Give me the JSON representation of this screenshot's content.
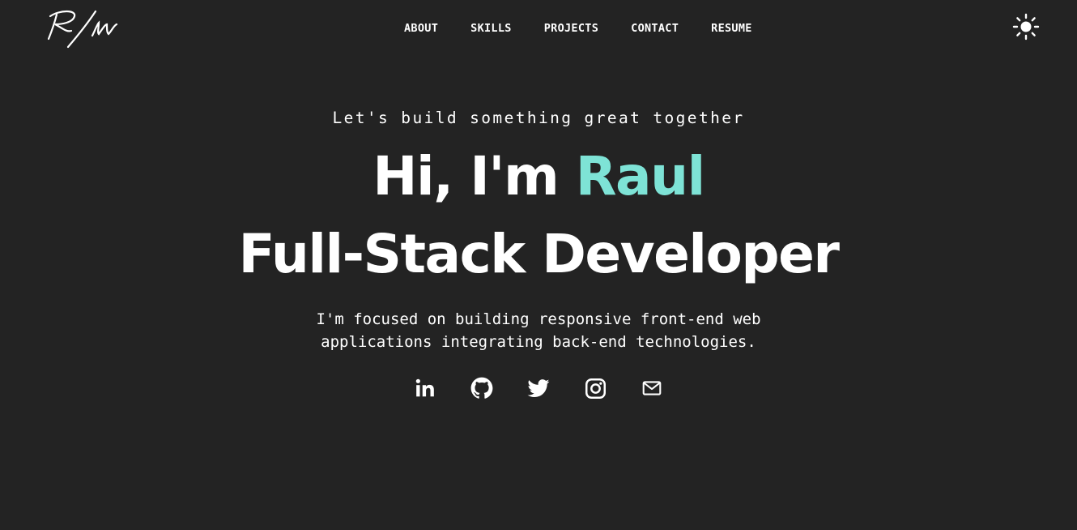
{
  "nav": {
    "logo_text": "R/M",
    "links": [
      {
        "label": "ABOUT"
      },
      {
        "label": "SKILLS"
      },
      {
        "label": "PROJECTS"
      },
      {
        "label": "CONTACT"
      },
      {
        "label": "RESUME"
      }
    ],
    "theme_icon": "sun-icon"
  },
  "hero": {
    "tagline": "Let's build something great together",
    "greeting": "Hi, I'm",
    "name": "Raul",
    "role": "Full-Stack Developer",
    "description": "I'm focused on building responsive front-end web applications integrating back-end technologies."
  },
  "social": [
    {
      "icon": "linkedin-icon"
    },
    {
      "icon": "github-icon"
    },
    {
      "icon": "twitter-icon"
    },
    {
      "icon": "instagram-icon"
    },
    {
      "icon": "mail-icon"
    }
  ],
  "colors": {
    "background": "#232323",
    "text": "#ffffff",
    "accent": "#7ee3d6"
  }
}
